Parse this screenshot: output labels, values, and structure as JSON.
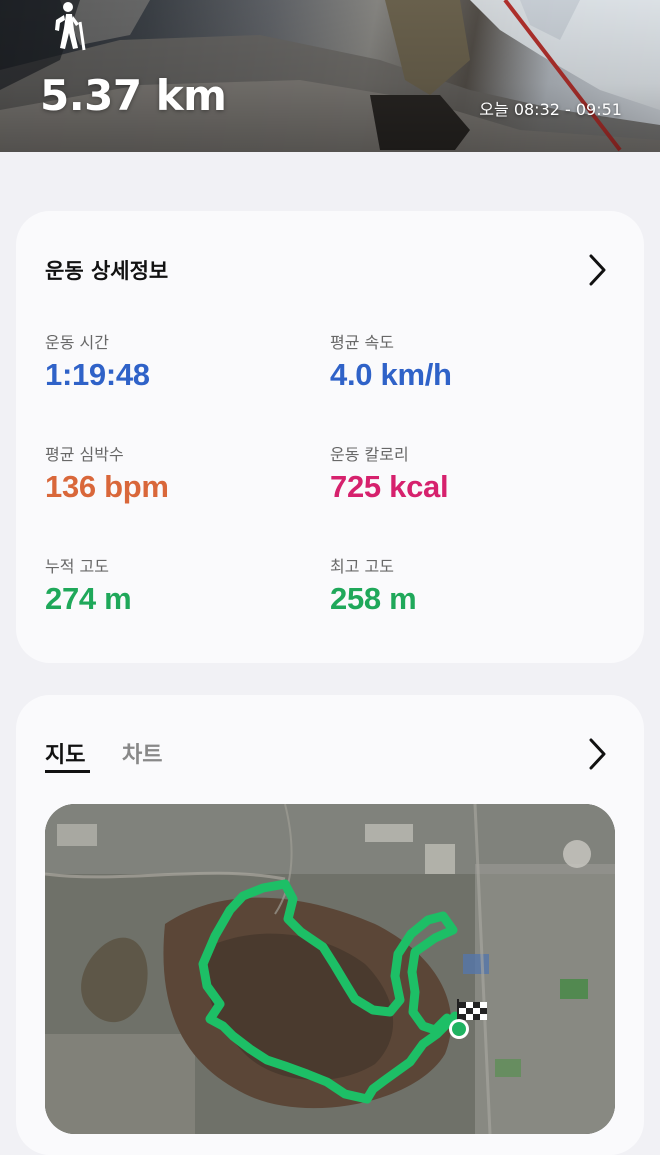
{
  "header": {
    "activity_icon": "hiking-icon",
    "distance": "5.37 km",
    "time_range": "오늘 08:32 - 09:51"
  },
  "details": {
    "title": "운동 상세정보",
    "more_icon": "chevron-right-icon",
    "stats": [
      {
        "label": "운동 시간",
        "value": "1:19:48",
        "color": "#2f62c8"
      },
      {
        "label": "평균 속도",
        "value": "4.0 km/h",
        "color": "#2f62c8"
      },
      {
        "label": "평균 심박수",
        "value": "136 bpm",
        "color": "#d9673a"
      },
      {
        "label": "운동 칼로리",
        "value": "725 kcal",
        "color": "#d6216d"
      },
      {
        "label": "누적 고도",
        "value": "274 m",
        "color": "#1fa85a"
      },
      {
        "label": "최고 고도",
        "value": "258 m",
        "color": "#1fa85a"
      }
    ]
  },
  "map_section": {
    "tabs": [
      "지도",
      "차트"
    ],
    "active_tab": "지도",
    "more_icon": "chevron-right-icon",
    "route_color": "#1dbf66",
    "start_icon": "start-point-icon",
    "finish_icon": "checkered-flag-icon"
  }
}
